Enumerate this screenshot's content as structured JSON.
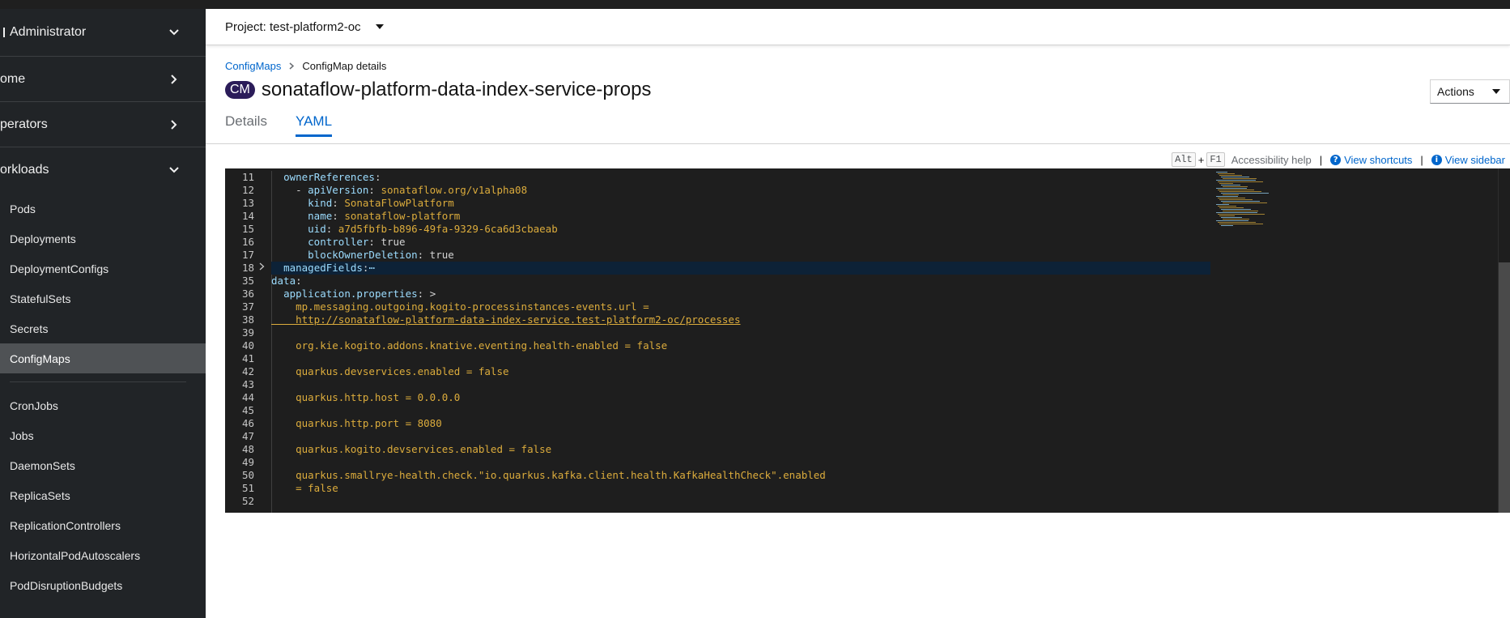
{
  "sidebar": {
    "perspective": "Administrator",
    "sections": [
      {
        "label": "ome",
        "expanded": false
      },
      {
        "label": "perators",
        "expanded": false
      },
      {
        "label": "orkloads",
        "expanded": true
      }
    ],
    "workloads_items": [
      "Pods",
      "Deployments",
      "DeploymentConfigs",
      "StatefulSets",
      "Secrets",
      "ConfigMaps"
    ],
    "workloads_items_2": [
      "CronJobs",
      "Jobs",
      "DaemonSets",
      "ReplicaSets",
      "ReplicationControllers",
      "HorizontalPodAutoscalers",
      "PodDisruptionBudgets"
    ],
    "active_item": "ConfigMaps"
  },
  "project": {
    "label": "Project: test-platform2-oc"
  },
  "breadcrumb": {
    "parent": "ConfigMaps",
    "current": "ConfigMap details"
  },
  "resource": {
    "badge": "CM",
    "name": "sonataflow-platform-data-index-service-props"
  },
  "actions_label": "Actions",
  "tabs": [
    {
      "label": "Details"
    },
    {
      "label": "YAML"
    }
  ],
  "active_tab": "YAML",
  "help": {
    "key1": "Alt",
    "plus": "+",
    "key2": "F1",
    "accessibility": "Accessibility help",
    "divider": "|",
    "shortcuts": "View shortcuts",
    "sidebar": "View sidebar"
  },
  "editor": {
    "line_numbers": [
      "11",
      "12",
      "13",
      "14",
      "15",
      "16",
      "17",
      "18",
      "35",
      "36",
      "37",
      "38",
      "39",
      "40",
      "41",
      "42",
      "43",
      "44",
      "45",
      "46",
      "47",
      "48",
      "49",
      "50",
      "51",
      "52"
    ],
    "lines": [
      "  ownerReferences:",
      "    - apiVersion: sonataflow.org/v1alpha08",
      "      kind: SonataFlowPlatform",
      "      name: sonataflow-platform",
      "      uid: a7d5fbfb-b896-49fa-9329-6ca6d3cbaeab",
      "      controller: true",
      "      blockOwnerDeletion: true",
      "  managedFields:⋯",
      "data:",
      "  application.properties: >",
      "    mp.messaging.outgoing.kogito-processinstances-events.url =",
      "    http://sonataflow-platform-data-index-service.test-platform2-oc/processes",
      "",
      "    org.kie.kogito.addons.knative.eventing.health-enabled = false",
      "",
      "    quarkus.devservices.enabled = false",
      "",
      "    quarkus.http.host = 0.0.0.0",
      "",
      "    quarkus.http.port = 8080",
      "",
      "    quarkus.kogito.devservices.enabled = false",
      "",
      "    quarkus.smallrye-health.check.\"io.quarkus.kafka.client.health.KafkaHealthCheck\".enabled",
      "    = false",
      ""
    ]
  },
  "colors": {
    "sidebar_bg": "#212427",
    "link": "#0066cc",
    "badge_bg": "#2b1c59",
    "editor_bg": "#1e1e1e",
    "yaml_key": "#9cdcfe",
    "yaml_value": "#ce9178",
    "yaml_string": "#dcac3c"
  }
}
